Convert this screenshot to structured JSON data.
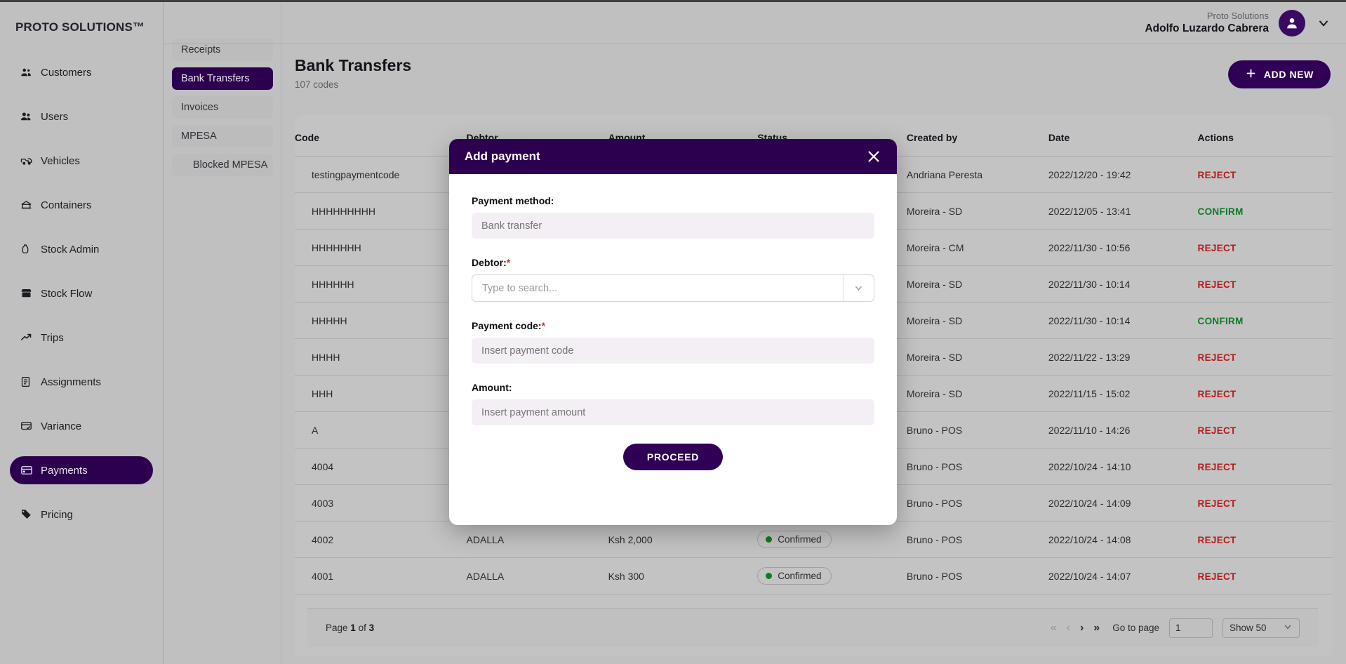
{
  "brand": {
    "logo_text": "PROTO SOLUTIONS™"
  },
  "header": {
    "org": "Proto Solutions",
    "user": "Adolfo Luzardo Cabrera",
    "avatar_icon": "user-avatar-icon",
    "caret_icon": "chevron-down-icon"
  },
  "sidebar": {
    "items": [
      {
        "label": "Customers",
        "icon": "customers-icon",
        "active": false
      },
      {
        "label": "Users",
        "icon": "users-icon",
        "active": false
      },
      {
        "label": "Vehicles",
        "icon": "vehicle-icon",
        "active": false
      },
      {
        "label": "Containers",
        "icon": "container-icon",
        "active": false
      },
      {
        "label": "Stock Admin",
        "icon": "stock-admin-icon",
        "active": false
      },
      {
        "label": "Stock Flow",
        "icon": "stock-flow-icon",
        "active": false
      },
      {
        "label": "Trips",
        "icon": "trips-icon",
        "active": false
      },
      {
        "label": "Assignments",
        "icon": "assignments-icon",
        "active": false
      },
      {
        "label": "Variance",
        "icon": "variance-icon",
        "active": false
      },
      {
        "label": "Payments",
        "icon": "payments-icon",
        "active": true
      },
      {
        "label": "Pricing",
        "icon": "pricing-tag-icon",
        "active": false
      }
    ]
  },
  "subnav": {
    "items": [
      {
        "label": "Receipts",
        "active": false,
        "indent": false
      },
      {
        "label": "Bank Transfers",
        "active": true,
        "indent": false
      },
      {
        "label": "Invoices",
        "active": false,
        "indent": false
      },
      {
        "label": "MPESA",
        "active": false,
        "indent": false
      },
      {
        "label": "Blocked MPESA",
        "active": false,
        "indent": true
      }
    ]
  },
  "page": {
    "title": "Bank Transfers",
    "subtitle": "107 codes",
    "add_new_label": "ADD NEW",
    "add_new_icon": "plus-icon"
  },
  "table": {
    "columns": [
      "Code",
      "Debtor",
      "Amount",
      "Status",
      "Created by",
      "Date",
      "Actions"
    ],
    "rows": [
      {
        "code": "testingpaymentcode",
        "debtor": "",
        "amount": "",
        "status": "",
        "created_by": "Andriana Peresta",
        "date": "2022/12/20 - 19:42",
        "action": "REJECT",
        "action_kind": "reject"
      },
      {
        "code": "HHHHHHHHH",
        "debtor": "",
        "amount": "",
        "status": "",
        "created_by": "Moreira - SD",
        "date": "2022/12/05 - 13:41",
        "action": "CONFIRM",
        "action_kind": "confirm"
      },
      {
        "code": "HHHHHHH",
        "debtor": "",
        "amount": "",
        "status": "",
        "created_by": "Moreira - CM",
        "date": "2022/11/30 - 10:56",
        "action": "REJECT",
        "action_kind": "reject"
      },
      {
        "code": "HHHHHH",
        "debtor": "",
        "amount": "",
        "status": "",
        "created_by": "Moreira - SD",
        "date": "2022/11/30 - 10:14",
        "action": "REJECT",
        "action_kind": "reject"
      },
      {
        "code": "HHHHH",
        "debtor": "",
        "amount": "",
        "status": "",
        "created_by": "Moreira - SD",
        "date": "2022/11/30 - 10:14",
        "action": "CONFIRM",
        "action_kind": "confirm"
      },
      {
        "code": "HHHH",
        "debtor": "",
        "amount": "",
        "status": "",
        "created_by": "Moreira - SD",
        "date": "2022/11/22 - 13:29",
        "action": "REJECT",
        "action_kind": "reject"
      },
      {
        "code": "HHH",
        "debtor": "",
        "amount": "",
        "status": "",
        "created_by": "Moreira - SD",
        "date": "2022/11/15 - 15:02",
        "action": "REJECT",
        "action_kind": "reject"
      },
      {
        "code": "A",
        "debtor": "",
        "amount": "",
        "status": "",
        "created_by": "Bruno - POS",
        "date": "2022/11/10 - 14:26",
        "action": "REJECT",
        "action_kind": "reject"
      },
      {
        "code": "4004",
        "debtor": "",
        "amount": "",
        "status": "",
        "created_by": "Bruno - POS",
        "date": "2022/10/24 - 14:10",
        "action": "REJECT",
        "action_kind": "reject"
      },
      {
        "code": "4003",
        "debtor": "",
        "amount": "",
        "status": "",
        "created_by": "Bruno - POS",
        "date": "2022/10/24 - 14:09",
        "action": "REJECT",
        "action_kind": "reject"
      },
      {
        "code": "4002",
        "debtor": "ADALLA",
        "amount": "Ksh 2,000",
        "status": "Confirmed",
        "created_by": "Bruno - POS",
        "date": "2022/10/24 - 14:08",
        "action": "REJECT",
        "action_kind": "reject"
      },
      {
        "code": "4001",
        "debtor": "ADALLA",
        "amount": "Ksh 300",
        "status": "Confirmed",
        "created_by": "Bruno - POS",
        "date": "2022/10/24 - 14:07",
        "action": "REJECT",
        "action_kind": "reject"
      }
    ],
    "status_dot_color": "#0c7c22"
  },
  "pagination": {
    "page_prefix": "Page",
    "page_number": "1",
    "page_of": "of",
    "page_total": "3",
    "first_icon": "«",
    "prev_icon": "‹",
    "next_icon": "›",
    "last_icon": "»",
    "goto_label": "Go to page",
    "goto_value": "1",
    "show_label": "Show 50",
    "show_caret_icon": "chevron-down-icon"
  },
  "modal": {
    "title": "Add payment",
    "close_icon": "close-icon",
    "fields": {
      "payment_method": {
        "label": "Payment method:",
        "placeholder": "Bank transfer",
        "value": "",
        "required": false
      },
      "debtor": {
        "label": "Debtor:",
        "placeholder": "Type to search...",
        "value": "",
        "required": true,
        "caret_icon": "chevron-down-icon"
      },
      "payment_code": {
        "label": "Payment code:",
        "placeholder": "Insert payment code",
        "value": "",
        "required": true
      },
      "amount": {
        "label": "Amount:",
        "placeholder": "Insert payment amount",
        "value": "",
        "required": false
      }
    },
    "submit_label": "PROCEED"
  },
  "colors": {
    "brand_purple": "#2c004f",
    "accent_purple": "#2f0055",
    "reject_red": "#b41b1b",
    "confirm_green": "#0e7a28",
    "status_green": "#0c7c22"
  }
}
